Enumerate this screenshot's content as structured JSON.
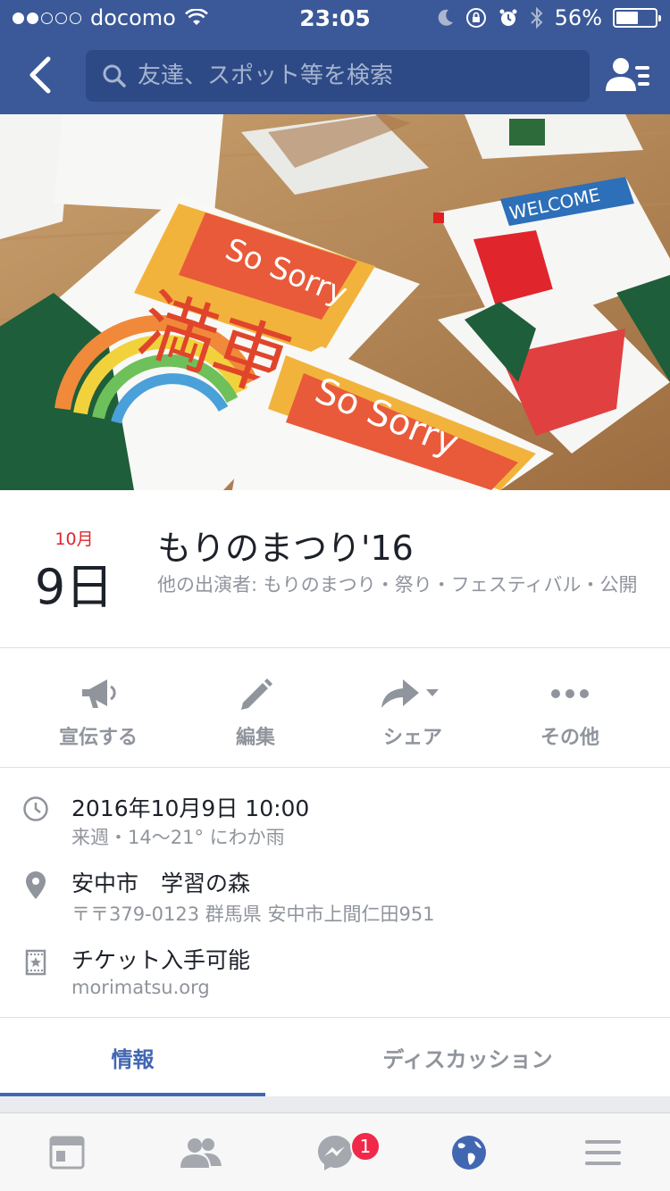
{
  "status_bar": {
    "carrier": "docomo",
    "time": "23:05",
    "battery_percent": "56%",
    "battery_level": 0.56,
    "signal_bars_filled": 2,
    "signal_bars_total": 5
  },
  "nav": {
    "search_placeholder": "友達、スポット等を検索"
  },
  "event": {
    "month": "10月",
    "day": "9日",
    "title": "もりのまつり'16",
    "subtitle": "他の出演者: もりのまつり・祭り・フェスティバル・公開"
  },
  "actions": [
    {
      "label": "宣伝する",
      "icon": "megaphone-icon"
    },
    {
      "label": "編集",
      "icon": "pencil-icon"
    },
    {
      "label": "シェア",
      "icon": "share-arrow-icon"
    },
    {
      "label": "その他",
      "icon": "more-dots-icon"
    }
  ],
  "info": {
    "datetime": "2016年10月9日 10:00",
    "datetime_sub": "来週・14〜21° にわか雨",
    "location": "安中市　学習の森",
    "address": "〒〒379-0123 群馬県 安中市上間仁田951",
    "tickets": "チケット入手可能",
    "tickets_url": "morimatsu.org"
  },
  "tabs": {
    "info_label": "情報",
    "discussion_label": "ディスカッション",
    "active": "情報"
  },
  "bottom_bar": {
    "messenger_badge": "1",
    "items": [
      "news-feed-icon",
      "friends-icon",
      "messenger-icon",
      "globe-icon",
      "menu-icon"
    ],
    "active": "globe-icon"
  },
  "colors": {
    "brand": "#3b5998",
    "accent": "#4267b2",
    "date_red": "#e0252d",
    "badge_red": "#f02849"
  }
}
